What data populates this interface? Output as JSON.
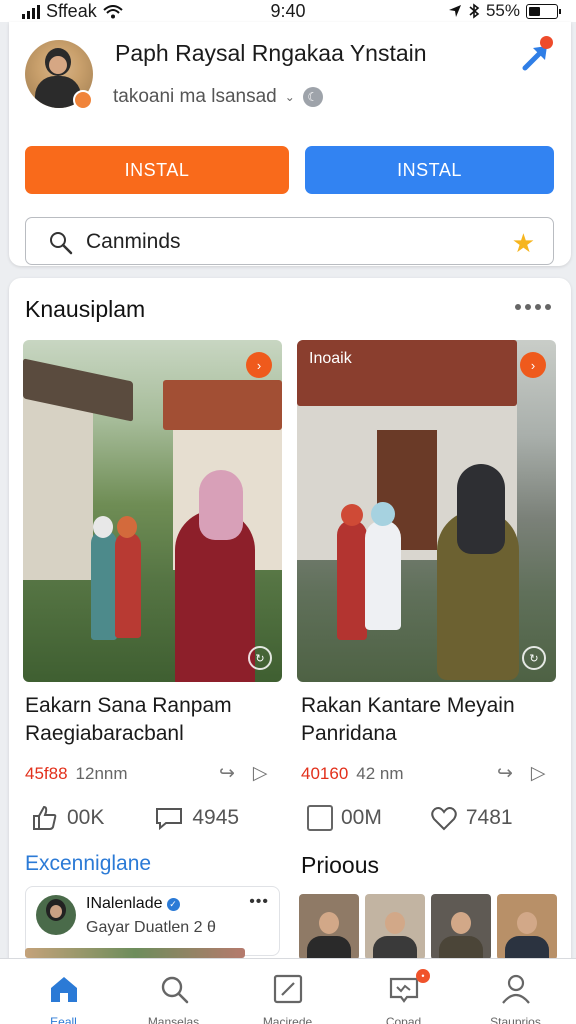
{
  "status": {
    "carrier": "Sffeak",
    "time": "9:40",
    "battery": "55%"
  },
  "profile": {
    "name": "Paph Raysal Rngakaa Ynstain",
    "subtitle": "takoani ma lsansad"
  },
  "buttons": {
    "primary": "INSTAL",
    "secondary": "INSTAL"
  },
  "search": {
    "value": "Canminds"
  },
  "section": {
    "title": "Knausiplam"
  },
  "videos": [
    {
      "thumb_label": "",
      "title": "Eakarn Sana Ranpam Raegiabaracbanl",
      "count": "45f88",
      "duration": "12nnm",
      "likes": "00K",
      "comments": "4945"
    },
    {
      "thumb_label": "Inoaik",
      "title": "Rakan Kantare Meyain Panridana",
      "count": "40160",
      "duration": "42 nm",
      "likes": "00M",
      "comments": "7481"
    }
  ],
  "subsections": {
    "left": "Excenniglane",
    "right": "Prioous"
  },
  "creator": {
    "name": "INalenlade",
    "subtitle": "Gayar Duatlen 2 θ"
  },
  "colors": {
    "orange": "#f96a1b",
    "blue": "#3283f2",
    "link": "#2b7ad6"
  },
  "tabs": [
    {
      "label": "Eeall",
      "icon": "home-icon"
    },
    {
      "label": "Manselas",
      "icon": "search-icon"
    },
    {
      "label": "Macirede",
      "icon": "edit-icon"
    },
    {
      "label": "Copad",
      "icon": "inbox-icon"
    },
    {
      "label": "Stauprios",
      "icon": "profile-icon"
    }
  ]
}
